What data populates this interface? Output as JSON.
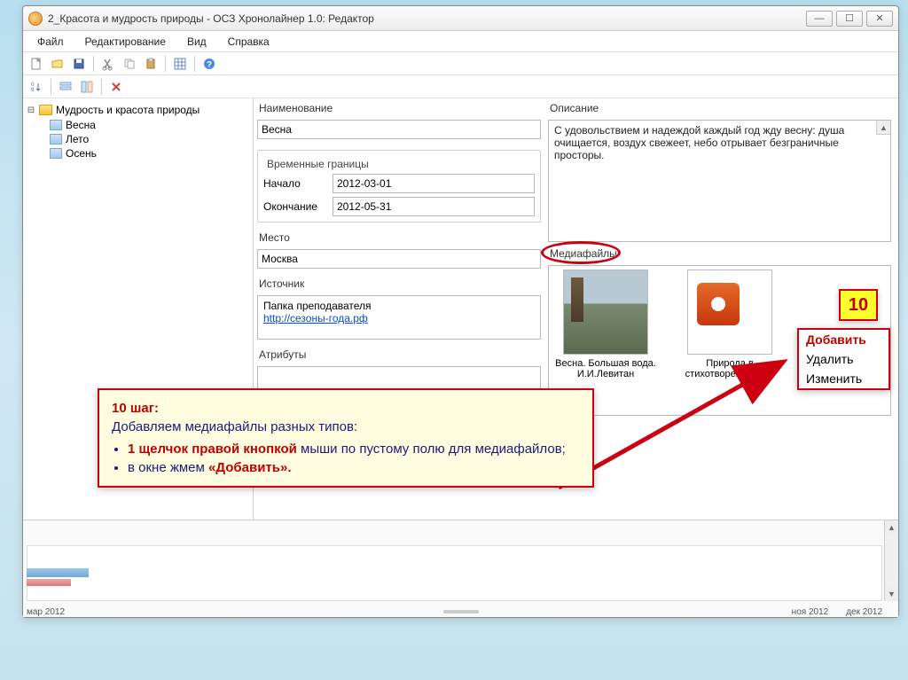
{
  "window": {
    "title": "2_Красота и мудрость природы - ОСЗ Хронолайнер 1.0: Редактор"
  },
  "menu": {
    "file": "Файл",
    "edit": "Редактирование",
    "view": "Вид",
    "help": "Справка"
  },
  "tree": {
    "root": "Мудрость и красота природы",
    "items": [
      "Весна",
      "Лето",
      "Осень"
    ]
  },
  "form": {
    "name_label": "Наименование",
    "name_value": "Весна",
    "timebox_title": "Временные границы",
    "start_label": "Начало",
    "start_value": "2012-03-01",
    "end_label": "Окончание",
    "end_value": "2012-05-31",
    "place_label": "Место",
    "place_value": "Москва",
    "source_label": "Источник",
    "source_text": "Папка преподавателя",
    "source_link": "http://сезоны-года.рф",
    "attrib_label": "Атрибуты",
    "desc_label": "Описание",
    "desc_text": "С удовольствием и надеждой каждый год жду весну: душа очищается, воздух свежеет, небо отрывает безграничные просторы.",
    "media_label": "Медиафайлы",
    "media1_caption": "Весна. Большая вода. И.И.Левитан",
    "media2_caption": "Природа в стихотворениях рус"
  },
  "timeline": {
    "ticks": [
      "мар 2012",
      "ноя 2012",
      "дек 2012"
    ]
  },
  "annotation": {
    "step_number": "10",
    "step_title": "10 шаг:",
    "line_main": "Добавляем медиафайлы разных типов:",
    "bullet1_bold": "1 щелчок правой кнопкой",
    "bullet1_rest": " мыши ",
    "bullet1_blue": "по пустому полю для медиафайлов;",
    "bullet2_pre": "в окне жмем ",
    "bullet2_red": "«Добавить»."
  },
  "context_menu": {
    "add": "Добавить",
    "delete": "Удалить",
    "edit": "Изменить"
  }
}
